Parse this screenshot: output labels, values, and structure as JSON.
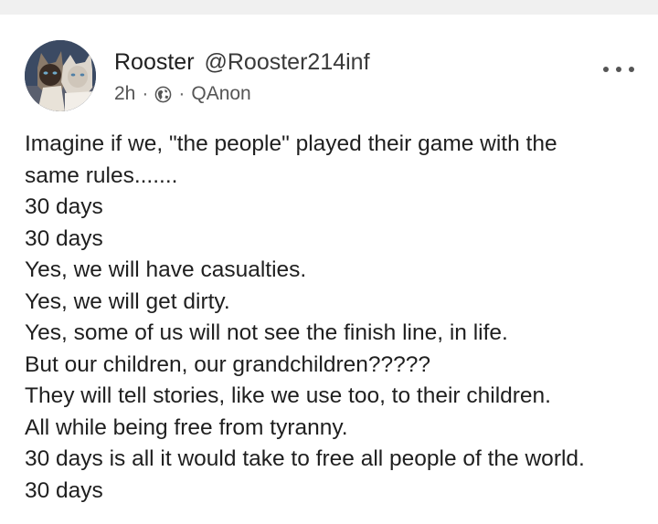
{
  "post": {
    "author_name": "Rooster",
    "handle": "@Rooster214inf",
    "time": "2h",
    "group": "QAnon",
    "lines": [
      "Imagine if we, \"the people\" played their game with the",
      "same rules.......",
      "30 days",
      "30 days",
      "Yes, we will have casualties.",
      "Yes, we will get dirty.",
      "Yes, some of us will not see the finish line, in life.",
      "But our children, our grandchildren?????",
      "They will tell stories, like we use too, to their children.",
      "All while being free from tyranny.",
      "30 days is all it would take to free all people of the world.",
      "30 days"
    ]
  },
  "icons": {
    "audience": "globe-icon",
    "menu": "more-options-icon"
  }
}
